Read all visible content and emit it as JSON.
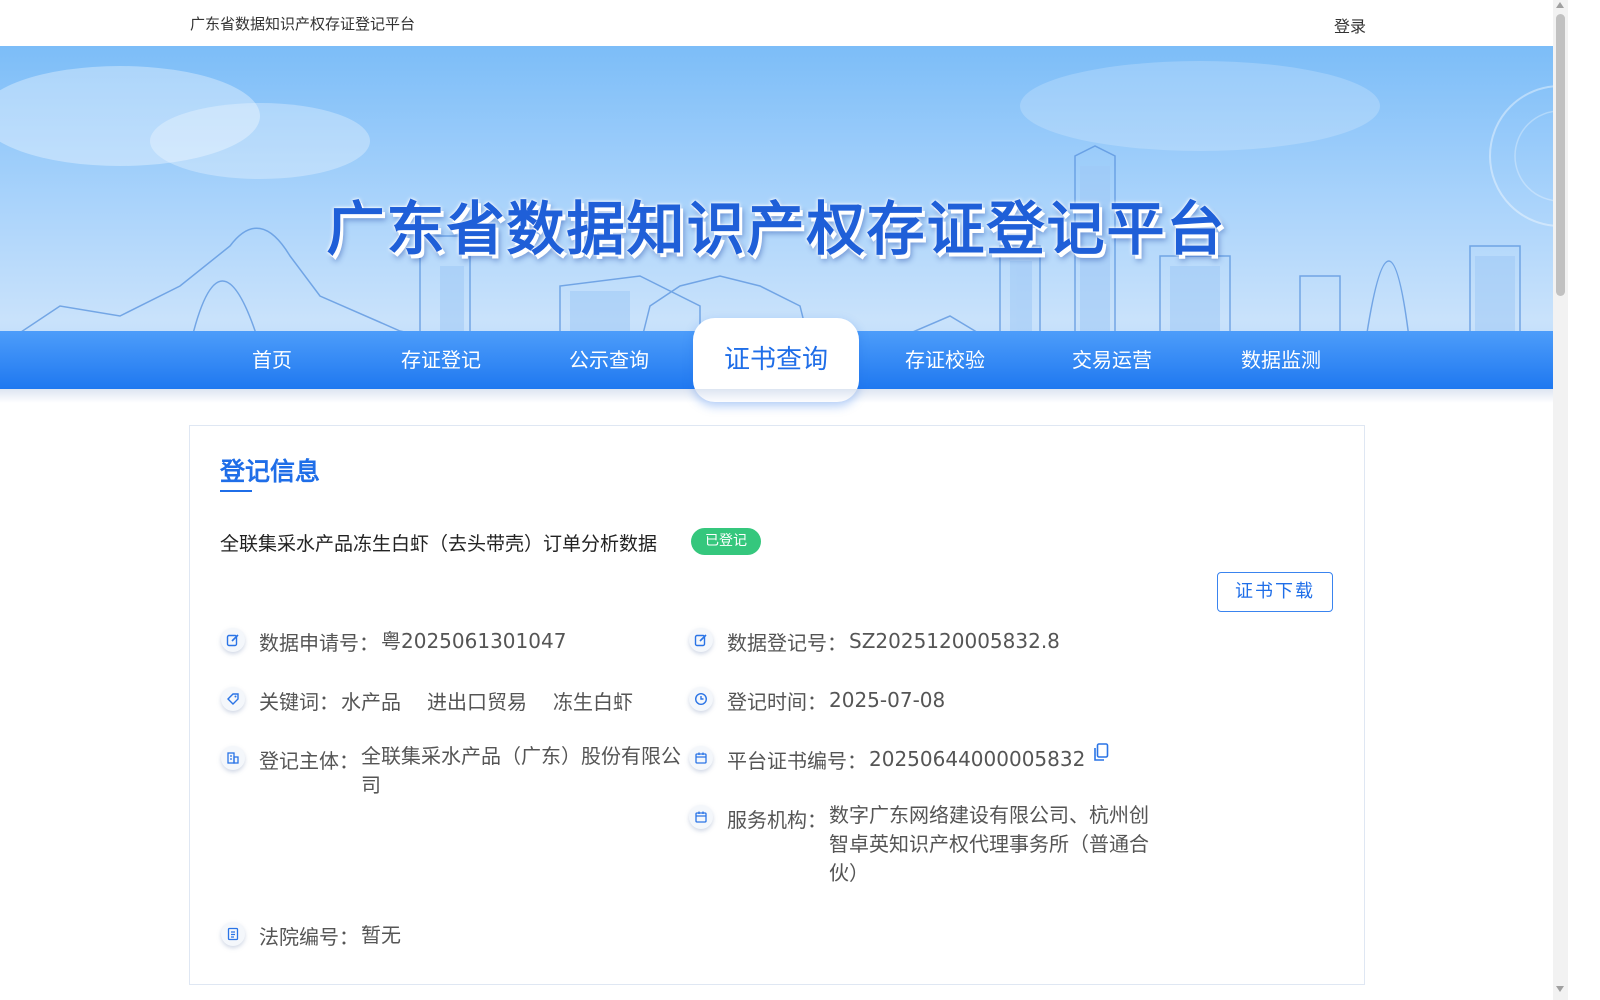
{
  "header": {
    "site_name": "广东省数据知识产权存证登记平台",
    "login_label": "登录"
  },
  "banner": {
    "title": "广东省数据知识产权存证登记平台"
  },
  "nav": {
    "items": [
      {
        "label": "首页",
        "active": false
      },
      {
        "label": "存证登记",
        "active": false
      },
      {
        "label": "公示查询",
        "active": false
      },
      {
        "label": "证书查询",
        "active": true
      },
      {
        "label": "存证校验",
        "active": false
      },
      {
        "label": "交易运营",
        "active": false
      },
      {
        "label": "数据监测",
        "active": false
      }
    ]
  },
  "card": {
    "section_title": "登记信息",
    "record_title": "全联集采水产品冻生白虾（去头带壳）订单分析数据",
    "status_badge": "已登记",
    "download_label": "证书下载",
    "fields": {
      "application_no_label": "数据申请号：",
      "application_no": "粤2025061301047",
      "registration_no_label": "数据登记号：",
      "registration_no": "SZ2025120005832.8",
      "keywords_label": "关键词：",
      "keywords": [
        "水产品",
        "进出口贸易",
        "冻生白虾"
      ],
      "registration_time_label": "登记时间：",
      "registration_time": "2025-07-08",
      "subject_label": "登记主体：",
      "subject": "全联集采水产品（广东）股份有限公司",
      "platform_cert_no_label": "平台证书编号：",
      "platform_cert_no": "20250644000005832",
      "service_org_label": "服务机构：",
      "service_org": "数字广东网络建设有限公司、杭州创智卓英知识产权代理事务所（普通合伙）",
      "court_no_label": "法院编号：",
      "court_no": "暂无"
    }
  },
  "colors": {
    "primary": "#1f6ee8",
    "nav_gradient_top": "#4d9dfa",
    "nav_gradient_bottom": "#1f78f0",
    "badge_green": "#35c77d"
  },
  "icons": {
    "application_no": "edit-icon",
    "registration_no": "edit-icon",
    "keywords": "tag-icon",
    "registration_time": "clock-icon",
    "subject": "building-icon",
    "platform_cert_no": "calendar-icon",
    "service_org": "calendar-icon",
    "court_no": "document-icon",
    "copy": "copy-icon"
  }
}
